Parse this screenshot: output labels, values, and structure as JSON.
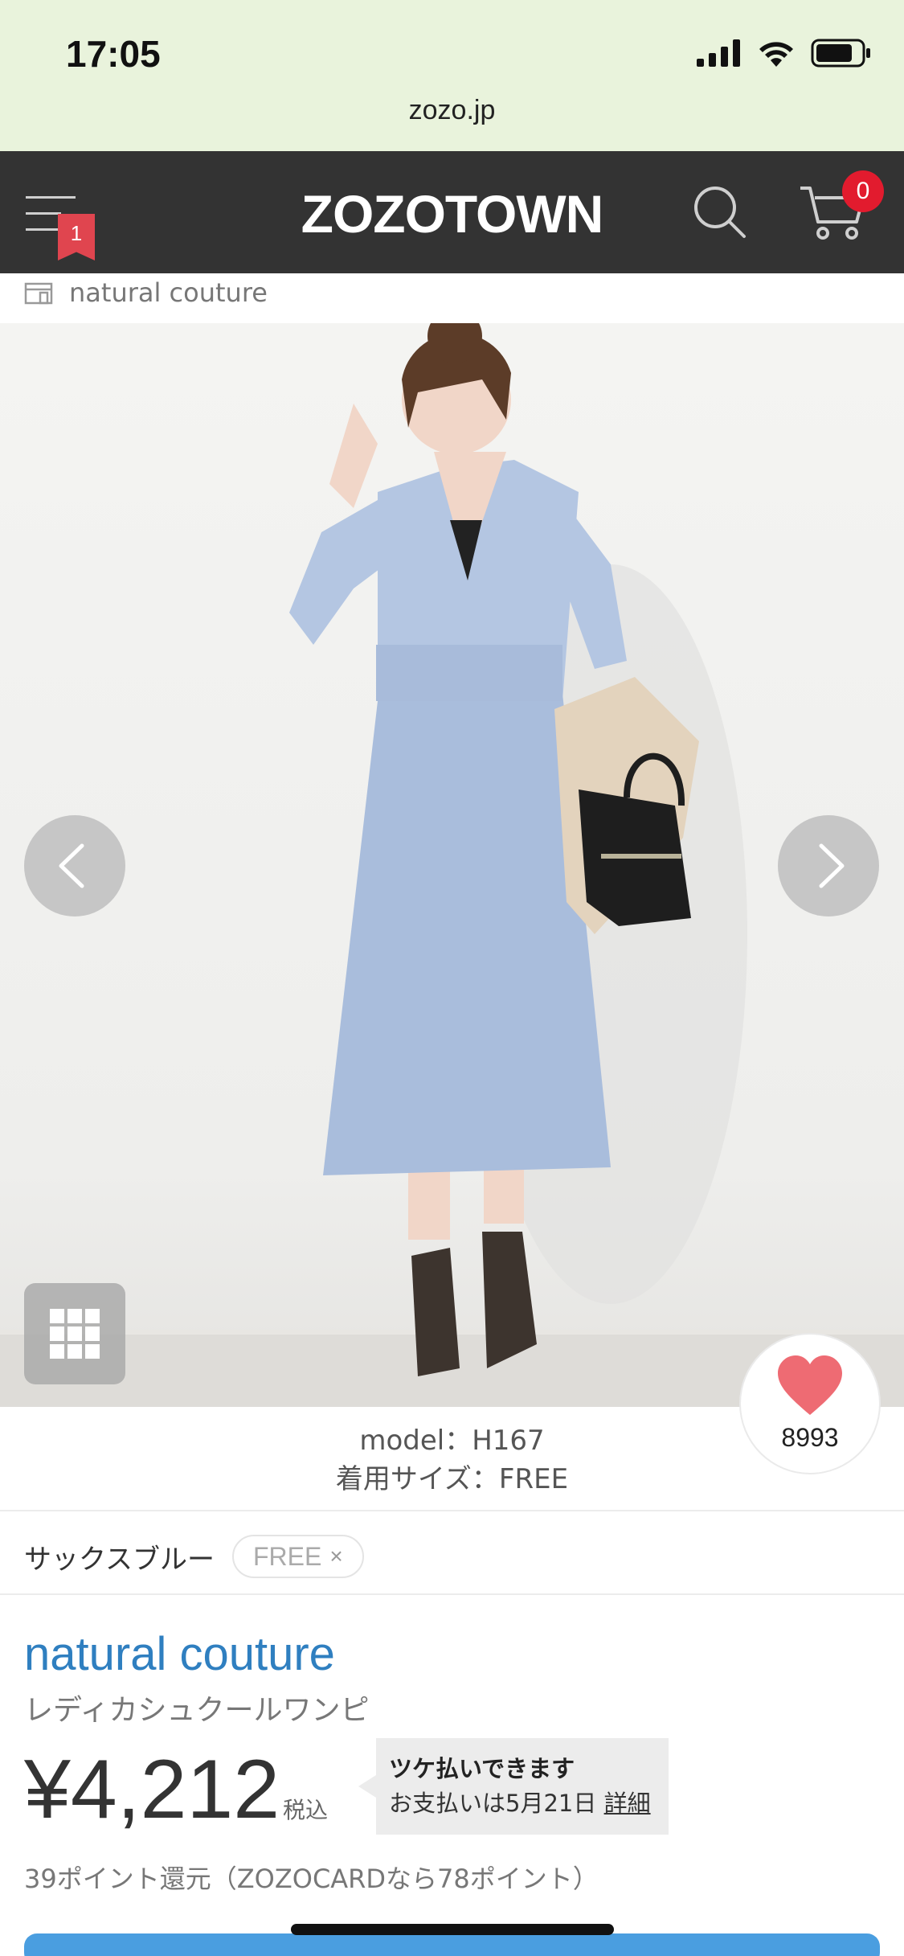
{
  "status_bar": {
    "time": "17:05",
    "url": "zozo.jp"
  },
  "header": {
    "logo": "ZOZOTOWN",
    "menu_badge": "1",
    "cart_count": "0",
    "icons": [
      "hamburger-menu-icon",
      "search-icon",
      "cart-icon"
    ]
  },
  "shop": {
    "name": "natural couture",
    "icon": "shop-icon"
  },
  "gallery": {
    "prev_icon": "chevron-left-icon",
    "next_icon": "chevron-right-icon",
    "grid_icon": "grid-icon",
    "favorite_icon": "heart-icon",
    "favorite_count": "8993",
    "heart_color": "#ee6b73"
  },
  "model_info": {
    "model": "model：H167",
    "size": "着用サイズ：FREE"
  },
  "variant": {
    "color": "サックスブルー",
    "size": "FREE",
    "remove_symbol": "×"
  },
  "product": {
    "brand": "natural couture",
    "name": "レディカシュクールワンピ",
    "price": "¥4,212",
    "tax_label": "税込",
    "payment_title": "ツケ払いできます",
    "payment_detail": "お支払いは5月21日",
    "payment_link": "詳細",
    "points": "39ポイント還元（ZOZOCARDなら78ポイント）"
  },
  "colors": {
    "header_bg": "#333333",
    "status_bg": "#e9f3dc",
    "brand_link": "#2f7fc0",
    "badge_red": "#e21b2e",
    "cta_blue": "#4a9ee0"
  }
}
